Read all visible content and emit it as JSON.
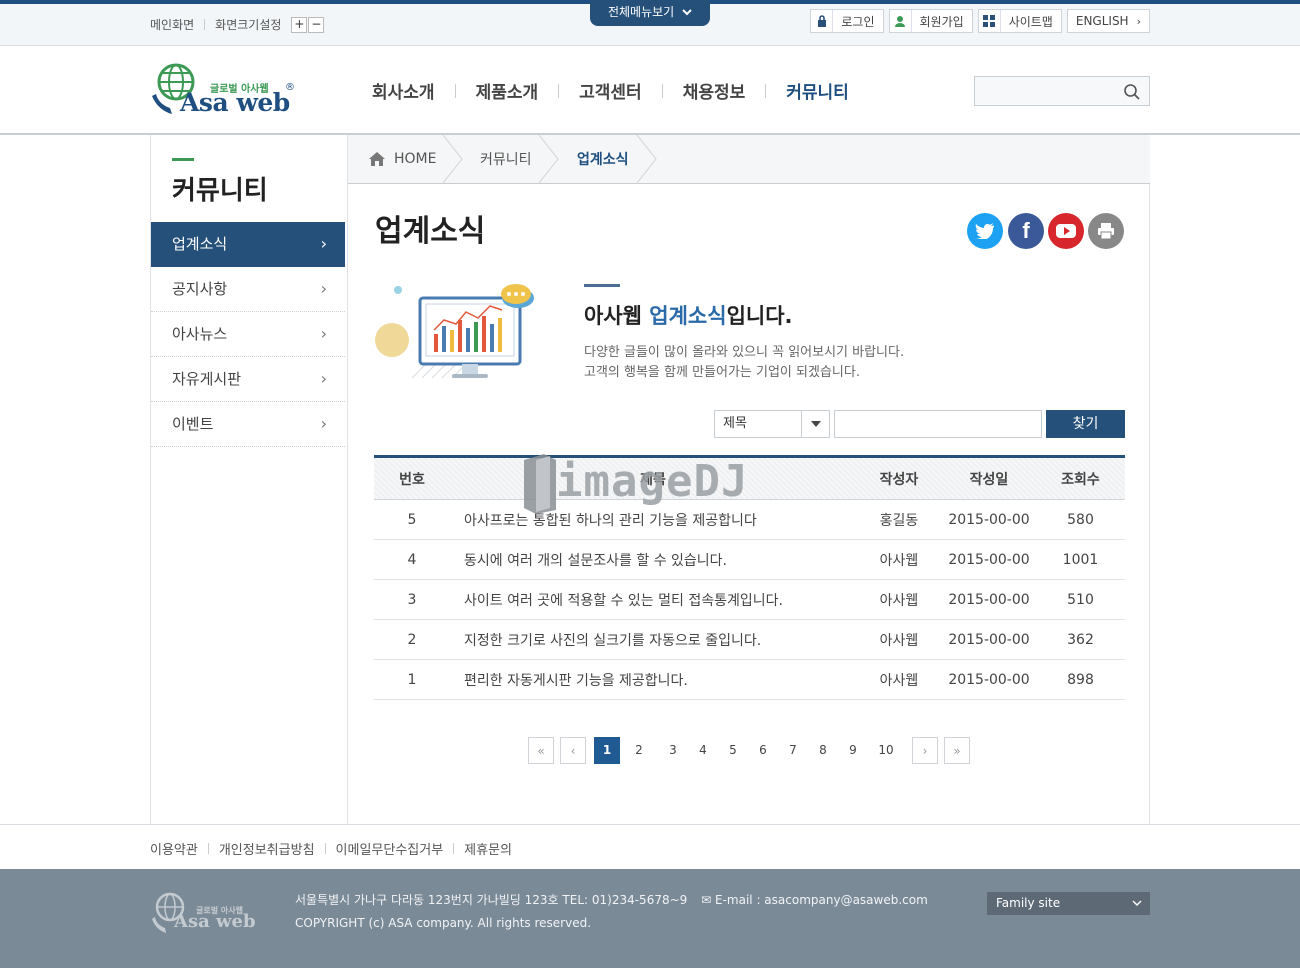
{
  "util": {
    "home": "메인화면",
    "zoom_label": "화면크기설정",
    "zoom_in": "+",
    "zoom_out": "−",
    "all_menu": "전체메뉴보기",
    "login": "로그인",
    "join": "회원가입",
    "sitemap": "사이트맵",
    "english": "ENGLISH"
  },
  "logo": {
    "small": "글로벌 아사웹",
    "big": "Asa web",
    "reg": "®"
  },
  "gnb": [
    "회사소개",
    "제품소개",
    "고객센터",
    "채용정보",
    "커뮤니티"
  ],
  "sidebar": {
    "title": "커뮤니티",
    "items": [
      {
        "label": "업계소식",
        "active": true
      },
      {
        "label": "공지사항"
      },
      {
        "label": "아사뉴스"
      },
      {
        "label": "자유게시판"
      },
      {
        "label": "이벤트"
      }
    ]
  },
  "breadcrumb": {
    "home": "HOME",
    "level1": "커뮤니티",
    "level2": "업계소식"
  },
  "page_title": "업계소식",
  "intro": {
    "prefix": "아사웹 ",
    "highlight": "업계소식",
    "suffix": "입니다.",
    "line1": "다양한 글들이 많이 올라와 있으니 꼭 읽어보시기 바랍니다.",
    "line2": "고객의 행복을 함께 만들어가는 기업이 되겠습니다."
  },
  "search": {
    "select_value": "제목",
    "button": "찾기"
  },
  "table": {
    "headers": {
      "no": "번호",
      "title": "제목",
      "author": "작성자",
      "date": "작성일",
      "views": "조회수"
    },
    "rows": [
      {
        "no": "5",
        "title": "아사프로는 통합된 하나의 관리 기능을 제공합니다",
        "author": "홍길동",
        "date": "2015-00-00",
        "views": "580"
      },
      {
        "no": "4",
        "title": "동시에 여러 개의 설문조사를 할 수 있습니다.",
        "author": "아사웹",
        "date": "2015-00-00",
        "views": "1001"
      },
      {
        "no": "3",
        "title": "사이트 여러 곳에 적용할 수 있는 멀티 접속통계입니다.",
        "author": "아사웹",
        "date": "2015-00-00",
        "views": "510"
      },
      {
        "no": "2",
        "title": "지정한 크기로 사진의 실크기를 자동으로 줄입니다.",
        "author": "아사웹",
        "date": "2015-00-00",
        "views": "362"
      },
      {
        "no": "1",
        "title": "편리한 자동게시판 기능을 제공합니다.",
        "author": "아사웹",
        "date": "2015-00-00",
        "views": "898"
      }
    ]
  },
  "pagination": {
    "pages": [
      "1",
      "2",
      "3",
      "4",
      "5",
      "6",
      "7",
      "8",
      "9",
      "10"
    ],
    "current": 1
  },
  "watermark": "imageDJ",
  "footer": {
    "links": [
      "이용약관",
      "개인정보취급방침",
      "이메일무단수집거부",
      "제휴문의"
    ],
    "address": "서울특별시 가나구 다라동 123번지 가나빌딩 123호  TEL: 01)234-5678~9",
    "email": "E-mail : asacompany@asaweb.com",
    "copyright": "COPYRIGHT (c) ASA company. All rights reserved.",
    "family_site": "Family site",
    "logo_small": "글로벌 아사웹",
    "logo_big": "Asa web"
  },
  "colors": {
    "primary": "#25507a",
    "accent_green": "#3c9a55",
    "highlight": "#2a6aa8",
    "footer_bg": "#7b8a97"
  }
}
